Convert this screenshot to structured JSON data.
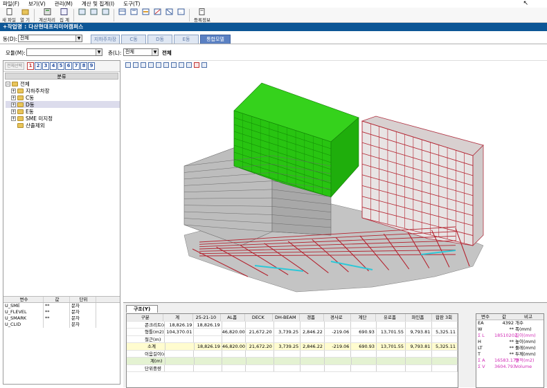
{
  "menu": [
    "파일(F)",
    "보기(V)",
    "관리(M)",
    "계산 및 집계(I)",
    "도구(T)"
  ],
  "toolbar": {
    "new_label": "새 파일",
    "open_label": "열 기",
    "calc_label": "계산처리",
    "sum_label": "집 계",
    "register_label": "등록정보"
  },
  "work": {
    "title": "+작업명 : 다산현대프리미어캠퍼스"
  },
  "building": {
    "label": "동(D):",
    "value": "전체"
  },
  "tabs": [
    "지하주차장",
    "C동",
    "D동",
    "E동",
    "통합모델"
  ],
  "model": {
    "label": "모듈(M):",
    "value": ""
  },
  "floor": {
    "label": "층(L):",
    "value": "전체",
    "display": "전체"
  },
  "left": {
    "select_all": "전체선택",
    "numbers": [
      "1",
      "2",
      "3",
      "4",
      "5",
      "6",
      "7",
      "8",
      "9"
    ],
    "tree_header": "분류",
    "tree": [
      {
        "label": "전체",
        "level": 0,
        "sign": "−"
      },
      {
        "label": "지하주차장",
        "level": 1,
        "sign": "+"
      },
      {
        "label": "C동",
        "level": 1,
        "sign": "+"
      },
      {
        "label": "D동",
        "level": 1,
        "sign": "+"
      },
      {
        "label": "E동",
        "level": 1,
        "sign": "+"
      },
      {
        "label": "SME 미지정",
        "level": 1,
        "sign": "+"
      },
      {
        "label": "산출제외",
        "level": 1,
        "sign": ""
      }
    ],
    "var_headers": [
      "변수",
      "값",
      "단위"
    ],
    "vars": [
      {
        "name": "U_SME",
        "value": "**",
        "unit": "문자"
      },
      {
        "name": "U_FLEVEL",
        "value": "**",
        "unit": "문자"
      },
      {
        "name": "U_SMARK",
        "value": "**",
        "unit": "문자"
      },
      {
        "name": "U_CLID",
        "value": "",
        "unit": "문자"
      }
    ]
  },
  "bottom": {
    "tab": "구조(Y)",
    "headers": [
      "구분",
      "계",
      "25-21-10",
      "AL폼",
      "DECK",
      "DH-BEAM",
      "갱폼",
      "경사로",
      "계단",
      "유로폼",
      "파인폼",
      "합판 3회"
    ],
    "rows": [
      {
        "cells": [
          "콘크리트(m3)",
          "18,826.19",
          "18,826.19",
          "",
          "",
          "",
          "",
          "",
          "",
          "",
          "",
          ""
        ],
        "style": ""
      },
      {
        "cells": [
          "형틀(m2)",
          "104,370.01",
          "",
          "46,820.00",
          "21,672.20",
          "3,739.25",
          "2,846.22",
          "-219.06",
          "690.93",
          "13,701.55",
          "9,793.81",
          "5,325.11"
        ],
        "style": ""
      },
      {
        "cells": [
          "철근(m)",
          "",
          "",
          "",
          "",
          "",
          "",
          "",
          "",
          "",
          "",
          ""
        ],
        "style": ""
      },
      {
        "cells": [
          "소계",
          "",
          "18,826.19",
          "46,820.00",
          "21,672.20",
          "3,739.25",
          "2,846.22",
          "-219.06",
          "690.93",
          "13,701.55",
          "9,793.81",
          "5,325.11"
        ],
        "style": "sub"
      },
      {
        "cells": [
          "이음길이(m)",
          "",
          "",
          "",
          "",
          "",
          "",
          "",
          "",
          "",
          "",
          ""
        ],
        "style": ""
      },
      {
        "cells": [
          "계(m)",
          "",
          "",
          "",
          "",
          "",
          "",
          "",
          "",
          "",
          "",
          ""
        ],
        "style": "green"
      },
      {
        "cells": [
          "단위중량",
          "",
          "",
          "",
          "",
          "",
          "",
          "",
          "",
          "",
          "",
          ""
        ],
        "style": ""
      }
    ],
    "right_headers": [
      "변수",
      "값",
      "비고"
    ],
    "right_rows": [
      {
        "name": "EA",
        "value": "4392",
        "note": "개수",
        "pink": false
      },
      {
        "name": "W",
        "value": "**",
        "note": "폭(mm)",
        "pink": false
      },
      {
        "name": "Σ L",
        "value": "18510202",
        "note": "길이(mm)",
        "pink": true
      },
      {
        "name": "H",
        "value": "**",
        "note": "높이(mm)",
        "pink": false
      },
      {
        "name": "LT",
        "value": "**",
        "note": "둘레(mm)",
        "pink": false
      },
      {
        "name": "T",
        "value": "**",
        "note": "두께(mm)",
        "pink": false
      },
      {
        "name": "Σ A",
        "value": "16583.179",
        "note": "면적(m2)",
        "pink": true
      },
      {
        "name": "Σ V",
        "value": "3604.793",
        "note": "Volume",
        "pink": true
      }
    ]
  },
  "colors": {
    "green_building": "#22cc11",
    "red_frame": "#c8323c",
    "concrete": "#bcbcbc",
    "accent": "#0c5696"
  }
}
